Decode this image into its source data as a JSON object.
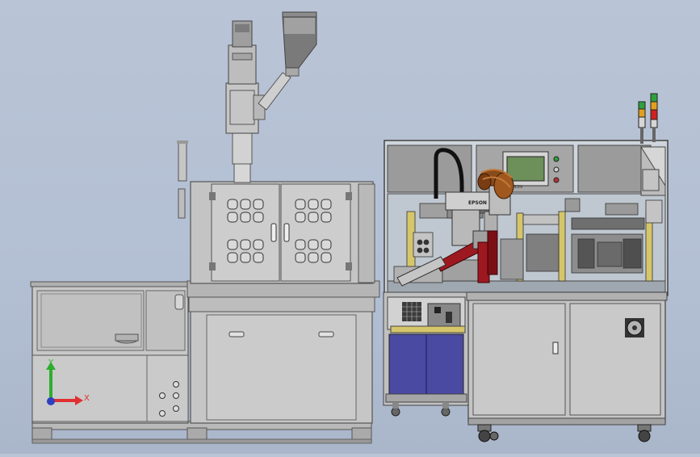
{
  "axis_triad": {
    "x_label": "X",
    "y_label": "Y",
    "x_color": "#e03030",
    "y_color": "#2eae2e",
    "z_color": "#2f3fbf"
  },
  "screen_brand": "EPSON",
  "robot_brand": "EPSON",
  "colors": {
    "background": "#b6c1d5",
    "machine_grey": "#c9c9c9",
    "frame_grey": "#9a9a9a",
    "cabinet_blue": "#4a4aa3",
    "robot_red": "#9e1820",
    "bundle_brown": "#8a4a1a",
    "hopper_dark": "#6f6f6f",
    "screen_green": "#6d8f5a",
    "beacon_red": "#d02020",
    "beacon_amber": "#e0a020",
    "beacon_green": "#2ea040"
  }
}
